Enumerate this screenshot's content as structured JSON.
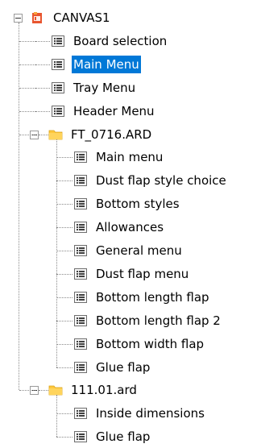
{
  "tree": {
    "root": {
      "label": "CANVAS1",
      "icon": "canvas-root-icon",
      "expanded": true
    },
    "root_items": [
      {
        "label": "Board selection",
        "icon": "menu-list-icon"
      },
      {
        "label": "Main Menu",
        "icon": "menu-list-icon",
        "selected": true
      },
      {
        "label": "Tray Menu",
        "icon": "menu-list-icon"
      },
      {
        "label": "Header Menu",
        "icon": "menu-list-icon"
      }
    ],
    "folders": [
      {
        "label": "FT_0716.ARD",
        "icon": "folder-icon",
        "expanded": true,
        "items": [
          {
            "label": "Main menu",
            "icon": "menu-list-icon"
          },
          {
            "label": "Dust flap style choice",
            "icon": "menu-list-icon"
          },
          {
            "label": "Bottom styles",
            "icon": "menu-list-icon"
          },
          {
            "label": "Allowances",
            "icon": "menu-list-icon"
          },
          {
            "label": "General menu",
            "icon": "menu-list-icon"
          },
          {
            "label": "Dust flap menu",
            "icon": "menu-list-icon"
          },
          {
            "label": "Bottom length flap",
            "icon": "menu-list-icon"
          },
          {
            "label": "Bottom length flap 2",
            "icon": "menu-list-icon"
          },
          {
            "label": "Bottom width flap",
            "icon": "menu-list-icon"
          },
          {
            "label": "Glue flap",
            "icon": "menu-list-icon"
          }
        ]
      },
      {
        "label": "111.01.ard",
        "icon": "folder-icon",
        "expanded": true,
        "items": [
          {
            "label": "Inside dimensions",
            "icon": "menu-list-icon"
          },
          {
            "label": "Glue flap",
            "icon": "menu-list-icon"
          }
        ]
      }
    ]
  },
  "colors": {
    "selection": "#0078d7",
    "folder": "#ffc83d",
    "root_icon": "#e8552f"
  }
}
